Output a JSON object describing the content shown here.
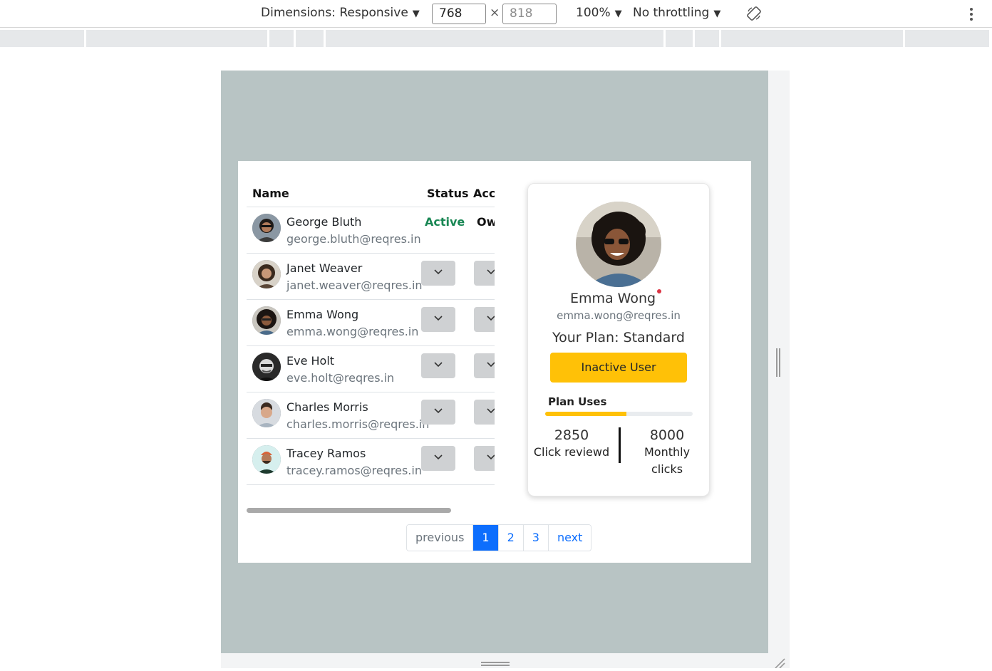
{
  "devtools": {
    "dimensions_label": "Dimensions: Responsive",
    "width": "768",
    "height": "818",
    "times": "×",
    "zoom": "100%",
    "throttling": "No throttling"
  },
  "table": {
    "headers": {
      "name": "Name",
      "status": "Status",
      "access": "Acc"
    },
    "rows": [
      {
        "name": "George Bluth",
        "email": "george.bluth@reqres.in",
        "status": "Active",
        "access": "Ow"
      },
      {
        "name": "Janet Weaver",
        "email": "janet.weaver@reqres.in"
      },
      {
        "name": "Emma Wong",
        "email": "emma.wong@reqres.in"
      },
      {
        "name": "Eve Holt",
        "email": "eve.holt@reqres.in"
      },
      {
        "name": "Charles Morris",
        "email": "charles.morris@reqres.in"
      },
      {
        "name": "Tracey Ramos",
        "email": "tracey.ramos@reqres.in"
      }
    ]
  },
  "pagination": {
    "previous": "previous",
    "pages": [
      "1",
      "2",
      "3"
    ],
    "active_page": "1",
    "next": "next"
  },
  "profile": {
    "name": "Emma Wong",
    "email": "emma.wong@reqres.in",
    "plan": "Your Plan: Standard",
    "status_button": "Inactive User",
    "plan_uses_label": "Plan Uses",
    "plan_uses_fraction": 0.55,
    "clicks_reviewed": "2850",
    "clicks_reviewed_label": "Click reviewd",
    "monthly_clicks": "8000",
    "monthly_clicks_label": "Monthly clicks"
  },
  "colors": {
    "accent": "#0d6efd",
    "warning": "#ffc107",
    "success": "#198754",
    "viewport_bg": "#b8c4c4"
  }
}
